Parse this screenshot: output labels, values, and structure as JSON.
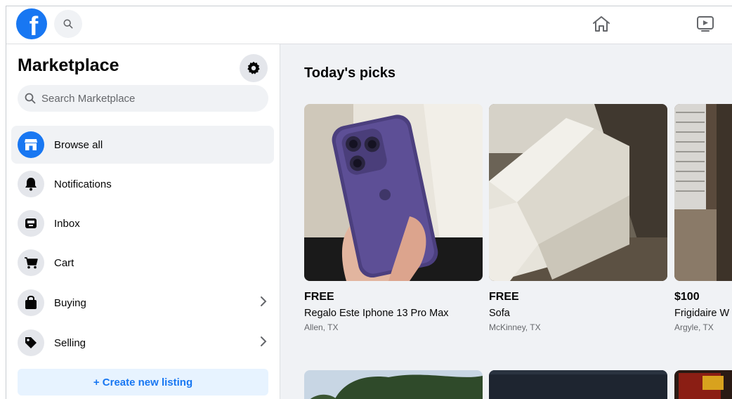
{
  "topbar": {
    "logo_letter": "f",
    "icons": [
      "facebook-logo",
      "search-icon",
      "home-icon",
      "video-icon"
    ]
  },
  "sidebar": {
    "title": "Marketplace",
    "search_placeholder": "Search Marketplace",
    "items": [
      {
        "label": "Browse all",
        "icon": "storefront-icon",
        "active": true
      },
      {
        "label": "Notifications",
        "icon": "bell-icon"
      },
      {
        "label": "Inbox",
        "icon": "inbox-icon"
      },
      {
        "label": "Cart",
        "icon": "cart-icon"
      },
      {
        "label": "Buying",
        "icon": "bag-icon",
        "chevron": true
      },
      {
        "label": "Selling",
        "icon": "tag-icon",
        "chevron": true
      }
    ],
    "create_button": "+ Create new listing"
  },
  "main": {
    "title": "Today's picks",
    "listings": [
      {
        "price": "FREE",
        "title": "Regalo Este Iphone 13 Pro Max",
        "location": "Allen, TX"
      },
      {
        "price": "FREE",
        "title": "Sofa",
        "location": "McKinney, TX"
      },
      {
        "price": "$100",
        "title": "Frigidaire W",
        "location": "Argyle, TX"
      }
    ]
  },
  "colors": {
    "brand": "#1877f2",
    "background": "#f0f2f5",
    "create_button_bg": "#e7f3ff"
  }
}
